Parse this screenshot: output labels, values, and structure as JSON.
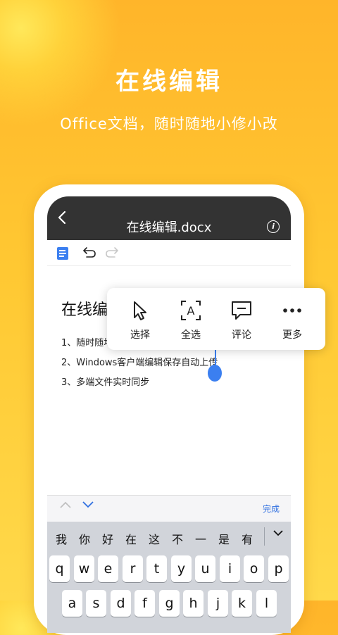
{
  "hero": {
    "title": "在线编辑",
    "subtitle": "Office文档，随时随地小修小改"
  },
  "app": {
    "back_icon": "back-chevron-icon",
    "file_title": "在线编辑.docx",
    "info_icon": "info-icon",
    "info_glyph": "i"
  },
  "toolbar": {
    "doc_icon": "document-icon",
    "undo_icon": "undo-icon",
    "redo_icon": "redo-icon"
  },
  "document": {
    "heading": "在线编",
    "lines": [
      "1、随时随地",
      "2、Windows客户端编辑保存自动上传",
      "3、多端文件实时同步"
    ]
  },
  "context_menu": {
    "items": [
      {
        "label": "选择",
        "icon": "cursor-icon"
      },
      {
        "label": "全选",
        "icon": "select-all-icon",
        "glyph": "A"
      },
      {
        "label": "评论",
        "icon": "comment-icon"
      },
      {
        "label": "更多",
        "icon": "more-icon"
      }
    ]
  },
  "accessory_bar": {
    "up_icon": "chevron-up-icon",
    "down_icon": "chevron-down-icon",
    "done_label": "完成"
  },
  "keyboard": {
    "candidates": [
      "我",
      "你",
      "好",
      "在",
      "这",
      "不",
      "一",
      "是",
      "有"
    ],
    "expand_icon": "expand-chevron-icon",
    "row1": [
      "q",
      "w",
      "e",
      "r",
      "t",
      "y",
      "u",
      "i",
      "o",
      "p"
    ],
    "row2": [
      "a",
      "s",
      "d",
      "f",
      "g",
      "h",
      "j",
      "k",
      "l"
    ]
  },
  "colors": {
    "accent_blue": "#3b7ff0",
    "titlebar_bg": "#333333",
    "hero_bg_top": "#ffb52a",
    "hero_bg_bottom": "#ffd94a"
  }
}
